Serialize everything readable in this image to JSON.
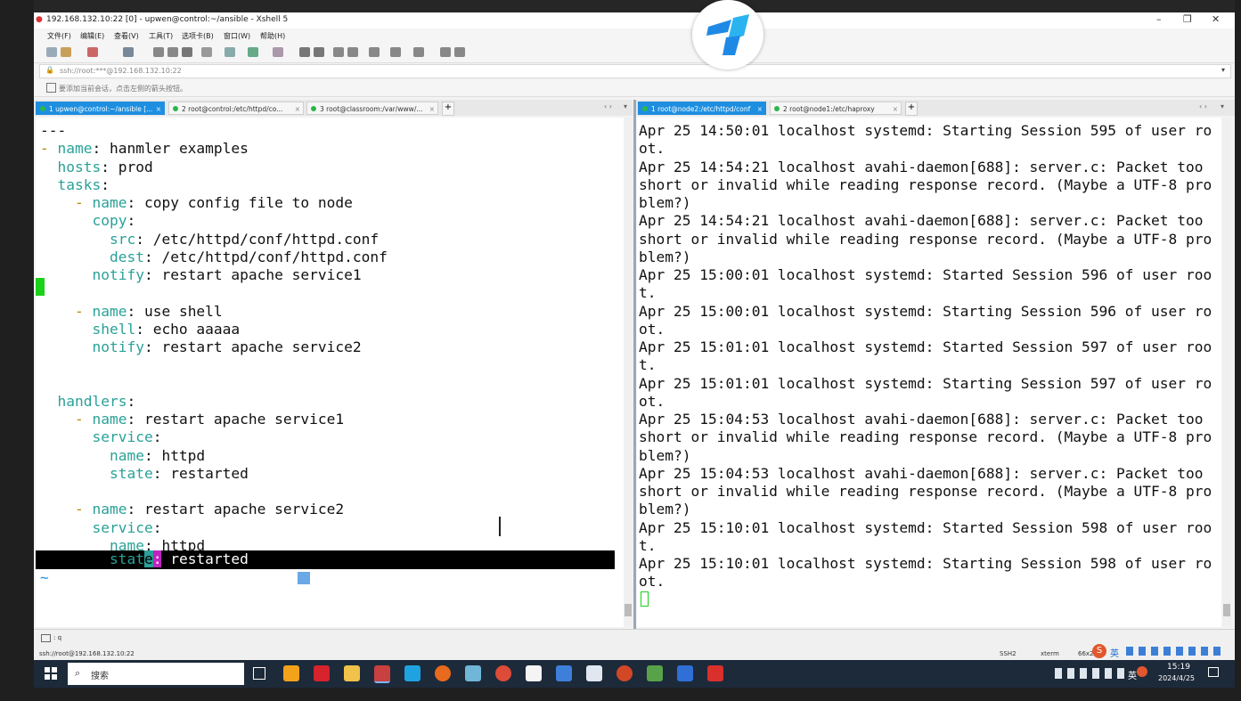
{
  "window": {
    "title": "192.168.132.10:22 [0] - upwen@control:~/ansible - Xshell 5",
    "controls": {
      "minimize": "–",
      "maximize": "❐",
      "close": "✕"
    }
  },
  "menu": [
    "文件(F)",
    "编辑(E)",
    "查看(V)",
    "工具(T)",
    "选项卡(B)",
    "窗口(W)",
    "帮助(H)"
  ],
  "address": "ssh://root:***@192.168.132.10:22",
  "hint": "要添加当前会话，点击左侧的箭头按钮。",
  "tabs_left": [
    {
      "label": "1 upwen@control:~/ansible [...",
      "active": true
    },
    {
      "label": "2 root@control:/etc/httpd/co...",
      "active": false
    },
    {
      "label": "3 root@classroom:/var/www/...",
      "active": false
    }
  ],
  "tabs_right": [
    {
      "label": "1 root@node2:/etc/httpd/conf",
      "active": true
    },
    {
      "label": "2 root@node1:/etc/haproxy",
      "active": false
    }
  ],
  "tab_add": "+",
  "left_terminal": {
    "lines": [
      [
        {
          "t": "---",
          "c": "s"
        }
      ],
      [
        {
          "t": "- ",
          "c": "d"
        },
        {
          "t": "name",
          "c": "k"
        },
        {
          "t": ": hanmler examples",
          "c": "s"
        }
      ],
      [
        {
          "t": "  hosts",
          "c": "k"
        },
        {
          "t": ": prod",
          "c": "s"
        }
      ],
      [
        {
          "t": "  tasks",
          "c": "k"
        },
        {
          "t": ":",
          "c": "s"
        }
      ],
      [
        {
          "t": "    - ",
          "c": "d"
        },
        {
          "t": "name",
          "c": "k"
        },
        {
          "t": ": copy config file to node",
          "c": "s"
        }
      ],
      [
        {
          "t": "      copy",
          "c": "k"
        },
        {
          "t": ":",
          "c": "s"
        }
      ],
      [
        {
          "t": "        src",
          "c": "k"
        },
        {
          "t": ": /etc/httpd/conf/httpd.conf",
          "c": "s"
        }
      ],
      [
        {
          "t": "        dest",
          "c": "k"
        },
        {
          "t": ": /etc/httpd/conf/httpd.conf",
          "c": "s"
        }
      ],
      [
        {
          "t": "      notify",
          "c": "k"
        },
        {
          "t": ": restart apache service1",
          "c": "s"
        }
      ],
      [
        {
          "t": "",
          "c": "s"
        }
      ],
      [
        {
          "t": "    - ",
          "c": "d"
        },
        {
          "t": "name",
          "c": "k"
        },
        {
          "t": ": use shell",
          "c": "s"
        }
      ],
      [
        {
          "t": "      shell",
          "c": "k"
        },
        {
          "t": ": echo aaaaa",
          "c": "s"
        }
      ],
      [
        {
          "t": "      notify",
          "c": "k"
        },
        {
          "t": ": restart apache service2",
          "c": "s"
        }
      ],
      [
        {
          "t": "",
          "c": "s"
        }
      ],
      [
        {
          "t": "",
          "c": "s"
        }
      ],
      [
        {
          "t": "  handlers",
          "c": "k"
        },
        {
          "t": ":",
          "c": "s"
        }
      ],
      [
        {
          "t": "    - ",
          "c": "d"
        },
        {
          "t": "name",
          "c": "k"
        },
        {
          "t": ": restart apache service1",
          "c": "s"
        }
      ],
      [
        {
          "t": "      service",
          "c": "k"
        },
        {
          "t": ":",
          "c": "s"
        }
      ],
      [
        {
          "t": "        name",
          "c": "k"
        },
        {
          "t": ": httpd",
          "c": "s"
        }
      ],
      [
        {
          "t": "        state",
          "c": "k"
        },
        {
          "t": ": restarted",
          "c": "s"
        }
      ],
      [
        {
          "t": "",
          "c": "s"
        }
      ],
      [
        {
          "t": "    - ",
          "c": "d"
        },
        {
          "t": "name",
          "c": "k"
        },
        {
          "t": ": restart apache service2",
          "c": "s"
        }
      ],
      [
        {
          "t": "      service",
          "c": "k"
        },
        {
          "t": ":",
          "c": "s"
        }
      ],
      [
        {
          "t": "        name",
          "c": "k"
        },
        {
          "t": ": httpd",
          "c": "s"
        }
      ]
    ],
    "highlight_line": {
      "prefix": "        stat",
      "cursor_char": "e",
      "colon": ":",
      "rest": " restarted"
    },
    "tilde": "~"
  },
  "right_terminal": {
    "lines": [
      "Apr 25 14:50:01 localhost systemd: Starting Session 595 of user ro",
      "ot.",
      "Apr 25 14:54:21 localhost avahi-daemon[688]: server.c: Packet too",
      "short or invalid while reading response record. (Maybe a UTF-8 pro",
      "blem?)",
      "Apr 25 14:54:21 localhost avahi-daemon[688]: server.c: Packet too",
      "short or invalid while reading response record. (Maybe a UTF-8 pro",
      "blem?)",
      "Apr 25 15:00:01 localhost systemd: Started Session 596 of user roo",
      "t.",
      "Apr 25 15:00:01 localhost systemd: Starting Session 596 of user ro",
      "ot.",
      "Apr 25 15:01:01 localhost systemd: Started Session 597 of user roo",
      "t.",
      "Apr 25 15:01:01 localhost systemd: Starting Session 597 of user ro",
      "ot.",
      "Apr 25 15:04:53 localhost avahi-daemon[688]: server.c: Packet too",
      "short or invalid while reading response record. (Maybe a UTF-8 pro",
      "blem?)",
      "Apr 25 15:04:53 localhost avahi-daemon[688]: server.c: Packet too",
      "short or invalid while reading response record. (Maybe a UTF-8 pro",
      "blem?)",
      "Apr 25 15:10:01 localhost systemd: Started Session 598 of user roo",
      "t.",
      "Apr 25 15:10:01 localhost systemd: Starting Session 598 of user ro",
      "ot."
    ]
  },
  "status": {
    "command": ": q",
    "connection": "ssh://root@192.168.132.10:22",
    "ssh": "SSH2",
    "term": "xterm",
    "size": "66x27"
  },
  "taskbar": {
    "search": "搜索",
    "time": "15:19",
    "date": "2024/4/25",
    "ime": "英"
  },
  "colors": {
    "tab_active": "#1e8fe0",
    "yaml_key": "#2aa198",
    "yaml_dash": "#b58900",
    "cursor_green": "#19d219"
  },
  "icons": [
    "start-icon",
    "search-icon",
    "task-view-icon",
    "app-icons"
  ]
}
